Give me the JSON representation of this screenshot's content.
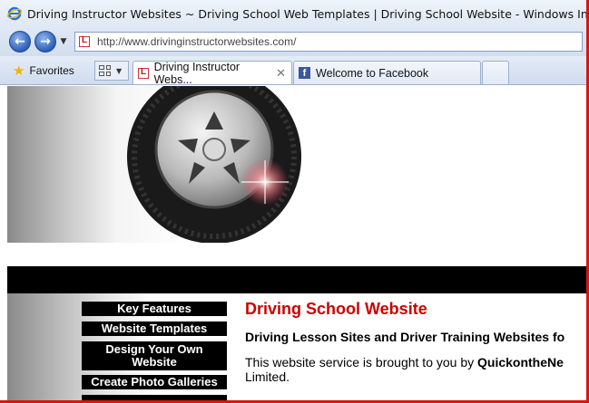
{
  "window": {
    "title": "Driving Instructor Websites ~ Driving School Web Templates | Driving School Website - Windows Internet Explorer"
  },
  "address_bar": {
    "url": "http://www.drivinginstructorwebsites.com/"
  },
  "favorites": {
    "label": "Favorites"
  },
  "tabs": [
    {
      "label": "Driving Instructor Webs...",
      "active": true
    },
    {
      "label": "Welcome to Facebook",
      "active": false
    }
  ],
  "sidebar": {
    "items": [
      {
        "label": "Key Features"
      },
      {
        "label": "Website Templates"
      },
      {
        "label": "Design Your Own Website"
      },
      {
        "label": "Create Photo Galleries"
      }
    ]
  },
  "main": {
    "heading": "Driving School Website",
    "subheading": "Driving Lesson Sites and Driver Training Websites fo",
    "intro_prefix": "This website service is brought to you by ",
    "intro_brand": "QuickontheNe",
    "intro_suffix": "Limited."
  },
  "colors": {
    "heading_red": "#cc0000",
    "window_border": "#d81414",
    "menu_bg": "#000000"
  }
}
